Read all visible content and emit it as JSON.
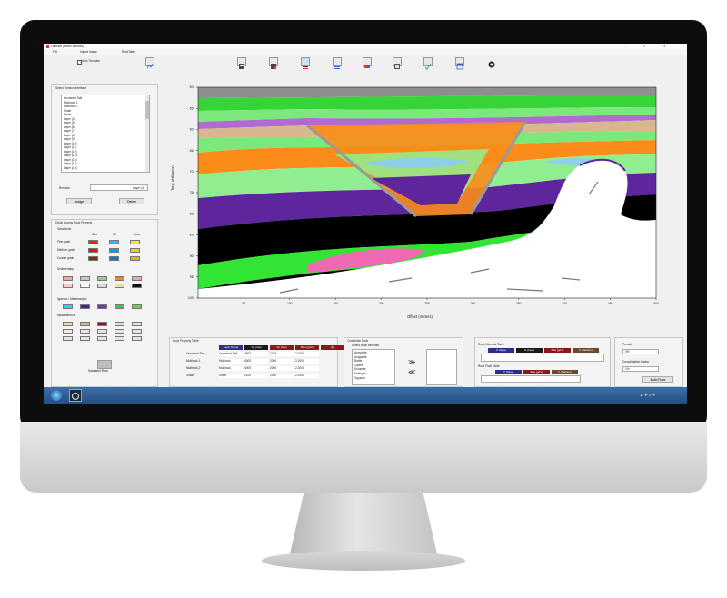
{
  "window": {
    "title": "Lateralis (Model Window)",
    "controls": [
      "–",
      "□",
      "✕"
    ]
  },
  "menu": [
    "File",
    "Import Image",
    "RockTable"
  ],
  "toolbar": {
    "auto_truncate_label": "Auto Truncate",
    "icons": [
      "import-section-icon",
      "export-section-icon",
      "layers-icon",
      "list-icon",
      "grid-color-icon",
      "stack-icon",
      "check-chart-icon",
      "window-icon",
      "settings-gear-icon"
    ]
  },
  "left_panel": {
    "select_horizon_label": "Select Horizon Interface",
    "horizons": [
      "Unnamed Salt",
      "Multirock 1",
      "Multirock 2",
      "Shale",
      "Shale",
      "Layer (4)",
      "Layer (5)",
      "Layer (6)",
      "Layer (7)",
      "Layer (8)",
      "Layer (9)",
      "Layer (10)",
      "Layer (11)",
      "Layer (12)",
      "Layer (13)",
      "Layer (14)",
      "Layer (15)",
      "Layer (16)"
    ],
    "rename_label": "Rename",
    "rename_value": "Layer (3)",
    "assign_button": "Assign",
    "delete_button": "Delete",
    "quick_access_label": "Quick Access Rock Property",
    "sandstone_label": "Sandstone",
    "fluid_headers": [
      "Gas",
      "Oil",
      "Brine"
    ],
    "grain_rows": [
      {
        "label": "Fine grain",
        "colors": [
          "#e8262a",
          "#3fb0ee",
          "#f2e62a"
        ]
      },
      {
        "label": "Medium grain",
        "colors": [
          "#c51f22",
          "#2f90d8",
          "#e8d21f"
        ]
      },
      {
        "label": "Coarse grain",
        "colors": [
          "#a8171a",
          "#1f72bf",
          "#d7b91a"
        ]
      }
    ],
    "sedimentary_label": "Sedimentary",
    "sedimentary_colors": [
      "#f4a3a3",
      "#c8c8c8",
      "#8fd18f",
      "#e8872a",
      "#f0a0c8",
      "#f7c9d0",
      "#ffffff",
      "#d8d8d8",
      "#f8d7a8",
      "#111111"
    ],
    "igneous_label": "Igneous / Metamorphic",
    "igneous_colors": [
      "#29d6f0",
      "#4b1f8c",
      "#6c3bb0",
      "#2fd12f",
      "#5ad65a"
    ],
    "misc_label": "Miscellaneous",
    "misc_colors": [
      "#f5d9b0",
      "#d8b48a",
      "#8a1a1a",
      "#dcdcdc",
      "#e6e6e6",
      "#ececec"
    ],
    "saturated_button": "Saturated Rock"
  },
  "plot": {
    "y_label": "Time (millisecs)",
    "x_label": "Offset (meters)",
    "y_ticks": [
      "500",
      "550",
      "600",
      "650",
      "700",
      "750",
      "800",
      "850",
      "900",
      "950",
      "1000"
    ],
    "x_ticks": [
      "50",
      "100",
      "150",
      "200",
      "250",
      "300",
      "350",
      "400",
      "450",
      "500"
    ]
  },
  "bottom": {
    "rock_property_label": "Rock Property Table",
    "rock_headers": [
      "Layer Name",
      "Vp (m/s)",
      "Vs (m/s)",
      "Rho (g/cc)",
      "Qp"
    ],
    "rock_header_colors": [
      "#2d2d8a",
      "#1a1a1a",
      "#8a1a1a",
      "#8a1a1a",
      "#8a1a1a"
    ],
    "rock_rows": [
      [
        "Unnamed Salt",
        "Unnamed Salt",
        "4500",
        "2475",
        "2.1500"
      ],
      [
        "Multirock 1",
        "Multirock",
        "4000",
        "2000",
        "2.2000"
      ],
      [
        "Multirock 2",
        "Multirock",
        "4000",
        "2000",
        "2.2000"
      ],
      [
        "Shale",
        "Shale",
        "2100",
        "1000",
        "2.2300"
      ]
    ],
    "customize_label": "Customize Rock",
    "select_minerals_label": "Select Rock Minerals",
    "minerals": [
      "Anhydrite",
      "Aragonite",
      "Barite",
      "Calcite",
      "Dolomite",
      "Feldspar",
      "Gypsum"
    ],
    "add_arrows": "≫",
    "remove_arrows": "≪",
    "rock_minerals_label": "Rock Minerals Table",
    "mineral_headers": [
      "K (Gpa)",
      "G (Gpa)",
      "Rho (g/cc)",
      "V (fraction)"
    ],
    "mineral_header_colors": [
      "#2d2d8a",
      "#1a1a1a",
      "#8a1a1a",
      "#6a4a2a"
    ],
    "rock_fluid_label": "Rock Fluid Table",
    "fluid_headers": [
      "K (Gpa)",
      "Rho (g/cc)",
      "V (fraction)"
    ],
    "fluid_header_colors": [
      "#2d2d8a",
      "#8a1a1a",
      "#6a4a2a"
    ],
    "porosity_label": "Porosity",
    "porosity_value": "0%",
    "consolidation_label": "Consolidation Factor",
    "consolidation_value": "1%",
    "build_rock_button": "Build Rock"
  },
  "taskbar": {
    "tray_text": "▲ ⚑ ♫ ✦"
  }
}
